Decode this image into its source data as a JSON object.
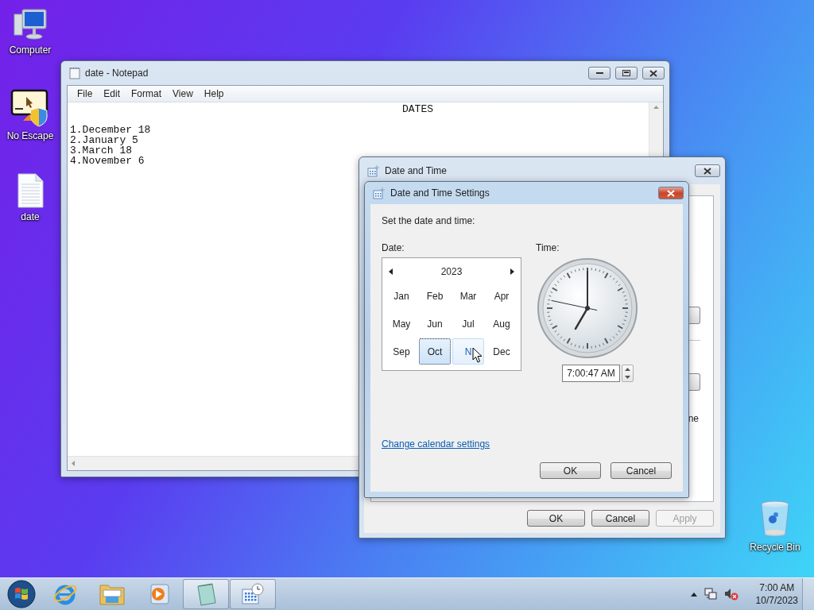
{
  "desktop": {
    "icons": [
      {
        "kind": "computer",
        "label": "Computer"
      },
      {
        "kind": "app",
        "label": "No Escape"
      },
      {
        "kind": "document",
        "label": "date"
      },
      {
        "kind": "recycle",
        "label": "Recycle Bin"
      }
    ]
  },
  "notepad": {
    "title": "date - Notepad",
    "menu": [
      "File",
      "Edit",
      "Format",
      "View",
      "Help"
    ],
    "lines": [
      {
        "kind": "heading",
        "text": "DATES"
      },
      {
        "kind": "blank"
      },
      {
        "kind": "body",
        "text": "1.December 18"
      },
      {
        "kind": "body",
        "text": "2.January 5"
      },
      {
        "kind": "body",
        "text": "3.March 18"
      },
      {
        "kind": "body",
        "text": "4.November 6"
      }
    ]
  },
  "date_time_window": {
    "title": "Date and Time",
    "fragment": "ne",
    "buttons": [
      {
        "label": "OK",
        "disabled": false
      },
      {
        "label": "Cancel",
        "disabled": false
      },
      {
        "label": "Apply",
        "disabled": true
      }
    ]
  },
  "settings_dialog": {
    "title": "Date and Time Settings",
    "prompt": "Set the date and time:",
    "date_label": "Date:",
    "time_label": "Time:",
    "calendar": {
      "year": "2023",
      "months": [
        {
          "label": "Jan",
          "selected": false,
          "hovered": false
        },
        {
          "label": "Feb",
          "selected": false,
          "hovered": false
        },
        {
          "label": "Mar",
          "selected": false,
          "hovered": false
        },
        {
          "label": "Apr",
          "selected": false,
          "hovered": false
        },
        {
          "label": "May",
          "selected": false,
          "hovered": false
        },
        {
          "label": "Jun",
          "selected": false,
          "hovered": false
        },
        {
          "label": "Jul",
          "selected": false,
          "hovered": false
        },
        {
          "label": "Aug",
          "selected": false,
          "hovered": false
        },
        {
          "label": "Sep",
          "selected": false,
          "hovered": false
        },
        {
          "label": "Oct",
          "selected": true,
          "hovered": false
        },
        {
          "label": "N",
          "selected": false,
          "hovered": true
        },
        {
          "label": "Dec",
          "selected": false,
          "hovered": false
        }
      ]
    },
    "time_value": "7:00:47 AM",
    "link": "Change calendar settings",
    "buttons": [
      "OK",
      "Cancel"
    ]
  },
  "taskbar": {
    "items": [
      {
        "kind": "start",
        "open": false
      },
      {
        "kind": "browser",
        "open": false
      },
      {
        "kind": "folder",
        "open": false
      },
      {
        "kind": "media",
        "open": false
      },
      {
        "kind": "notepad",
        "open": true
      },
      {
        "kind": "datetime",
        "open": true
      }
    ],
    "clock": {
      "time": "7:00 AM",
      "date": "10/7/2023"
    }
  }
}
